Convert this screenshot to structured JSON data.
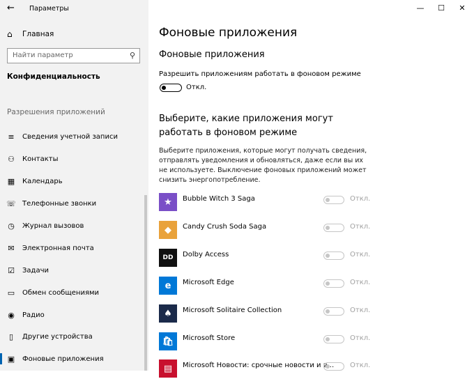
{
  "window": {
    "title": "Параметры",
    "controls": [
      "—",
      "☐",
      "✕"
    ]
  },
  "sidebar": {
    "home_label": "Главная",
    "search_placeholder": "Найти параметр",
    "category": "Конфиденциальность",
    "section": "Разрешения приложений",
    "items": [
      {
        "label": "Сведения учетной записи",
        "icon": "account-info-icon",
        "glyph": "≡"
      },
      {
        "label": "Контакты",
        "icon": "contacts-icon",
        "glyph": "⚇"
      },
      {
        "label": "Календарь",
        "icon": "calendar-icon",
        "glyph": "▦"
      },
      {
        "label": "Телефонные звонки",
        "icon": "phone-icon",
        "glyph": "☏"
      },
      {
        "label": "Журнал вызовов",
        "icon": "call-history-icon",
        "glyph": "◷"
      },
      {
        "label": "Электронная почта",
        "icon": "email-icon",
        "glyph": "✉"
      },
      {
        "label": "Задачи",
        "icon": "tasks-icon",
        "glyph": "☑"
      },
      {
        "label": "Обмен сообщениями",
        "icon": "messaging-icon",
        "glyph": "▭"
      },
      {
        "label": "Радио",
        "icon": "radio-icon",
        "glyph": "◉"
      },
      {
        "label": "Другие устройства",
        "icon": "devices-icon",
        "glyph": "▯"
      },
      {
        "label": "Фоновые приложения",
        "icon": "background-apps-icon",
        "glyph": "▣"
      }
    ]
  },
  "main": {
    "title": "Фоновые приложения",
    "subtitle": "Фоновые приложения",
    "allow_label": "Разрешить приложениям работать в фоновом режиме",
    "allow_state": "Откл.",
    "choose_heading": "Выберите, какие приложения могут работать в фоновом режиме",
    "description": "Выберите приложения, которые могут получать сведения, отправлять уведомления и обновляться, даже если вы их не используете. Выключение фоновых приложений может снизить энергопотребление.",
    "apps": [
      {
        "name": "Bubble Witch 3 Saga",
        "state": "Откл.",
        "color": "#7a4fc7",
        "glyph": "★"
      },
      {
        "name": "Candy Crush Soda Saga",
        "state": "Откл.",
        "color": "#e9a23b",
        "glyph": "◆"
      },
      {
        "name": "Dolby Access",
        "state": "Откл.",
        "color": "#111111",
        "glyph": "DD"
      },
      {
        "name": "Microsoft Edge",
        "state": "Откл.",
        "color": "#0078d7",
        "glyph": "e"
      },
      {
        "name": "Microsoft Solitaire Collection",
        "state": "Откл.",
        "color": "#1b2a4a",
        "glyph": "♠"
      },
      {
        "name": "Microsoft Store",
        "state": "Откл.",
        "color": "#0078d7",
        "glyph": "🛍"
      },
      {
        "name": "Microsoft Новости: срочные новости и в...",
        "state": "Откл.",
        "color": "#c8102e",
        "glyph": "▤"
      }
    ]
  }
}
